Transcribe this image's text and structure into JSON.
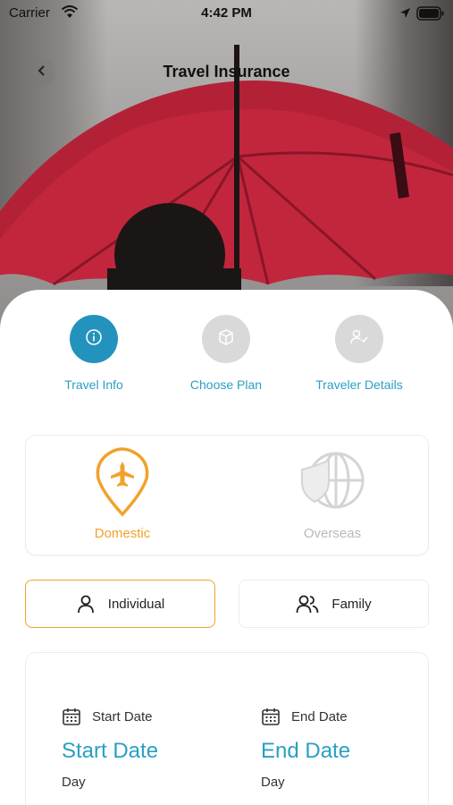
{
  "status_bar": {
    "carrier": "Carrier",
    "time": "4:42 PM"
  },
  "nav": {
    "title": "Travel Insurance",
    "back_icon": "chevron-left-icon"
  },
  "steps": [
    {
      "label": "Travel Info",
      "icon": "info-icon",
      "state": "active"
    },
    {
      "label": "Choose Plan",
      "icon": "box-icon",
      "state": "inactive"
    },
    {
      "label": "Traveler Details",
      "icon": "user-check-icon",
      "state": "inactive"
    }
  ],
  "trip_type": {
    "options": [
      {
        "label": "Domestic",
        "icon": "location-plane-icon",
        "selected": true
      },
      {
        "label": "Overseas",
        "icon": "globe-shield-icon",
        "selected": false
      }
    ]
  },
  "coverage": {
    "options": [
      {
        "label": "Individual",
        "icon": "user-icon",
        "selected": true
      },
      {
        "label": "Family",
        "icon": "users-icon",
        "selected": false
      }
    ]
  },
  "dates": {
    "start": {
      "heading": "Start Date",
      "value": "Start Date",
      "sub": "Day"
    },
    "end": {
      "heading": "End Date",
      "value": "End Date",
      "sub": "Day"
    }
  },
  "colors": {
    "accent_blue": "#2393be",
    "link_blue": "#2a9fc4",
    "accent_orange": "#f0a22c",
    "inactive_gray": "#d9d9d9",
    "umbrella_red": "#c2263d"
  }
}
